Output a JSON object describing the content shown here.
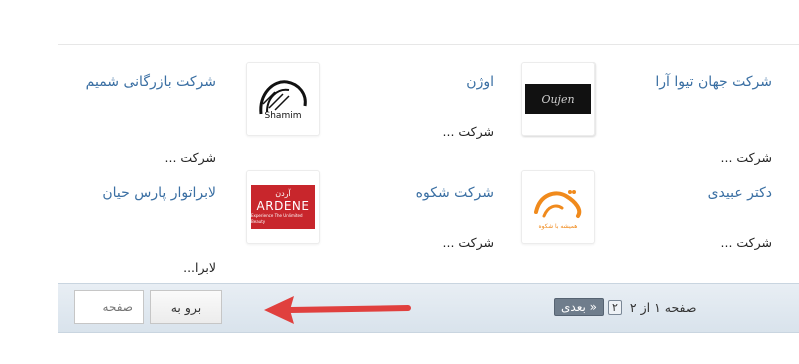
{
  "companies": [
    {
      "name": "شرکت جهان تیوا آرا",
      "desc": "شرکت ...",
      "logo_icon": "company-logo-icon"
    },
    {
      "name": "اوژن",
      "desc": "شرکت ...",
      "logo_icon": "ojen-logo-icon",
      "logo_text": "Oujen"
    },
    {
      "name": "شرکت بازرگانی شمیم",
      "desc": "شرکت ...",
      "logo_icon": "shamim-logo-icon",
      "logo_text": "Shamim"
    },
    {
      "name": "دکتر عبیدی",
      "desc": "شرکت ...",
      "logo_icon": "dr-obeidi-logo-icon"
    },
    {
      "name": "شرکت شکوه",
      "desc": "شرکت ...",
      "logo_icon": "shokouh-logo-icon",
      "logo_text": "شکوه",
      "logo_sub": "همیشه با شکوه"
    },
    {
      "name": "لابراتوار پارس حیان",
      "desc": "لابرا...",
      "logo_icon": "ardene-logo-icon",
      "logo_text": "ARDENE",
      "logo_fa": "آردن",
      "logo_sub": "Experience The Unlimited Beauty"
    }
  ],
  "pager": {
    "page_input_placeholder": "صفحه",
    "go_label": "برو به",
    "next_label": "بعدی »",
    "page_number": "۲",
    "page_info": "صفحه ۱ از ۲"
  },
  "colors": {
    "link": "#3a6fa3",
    "pager_bg": "#dfe7ef",
    "arrow": "#e0403e"
  }
}
